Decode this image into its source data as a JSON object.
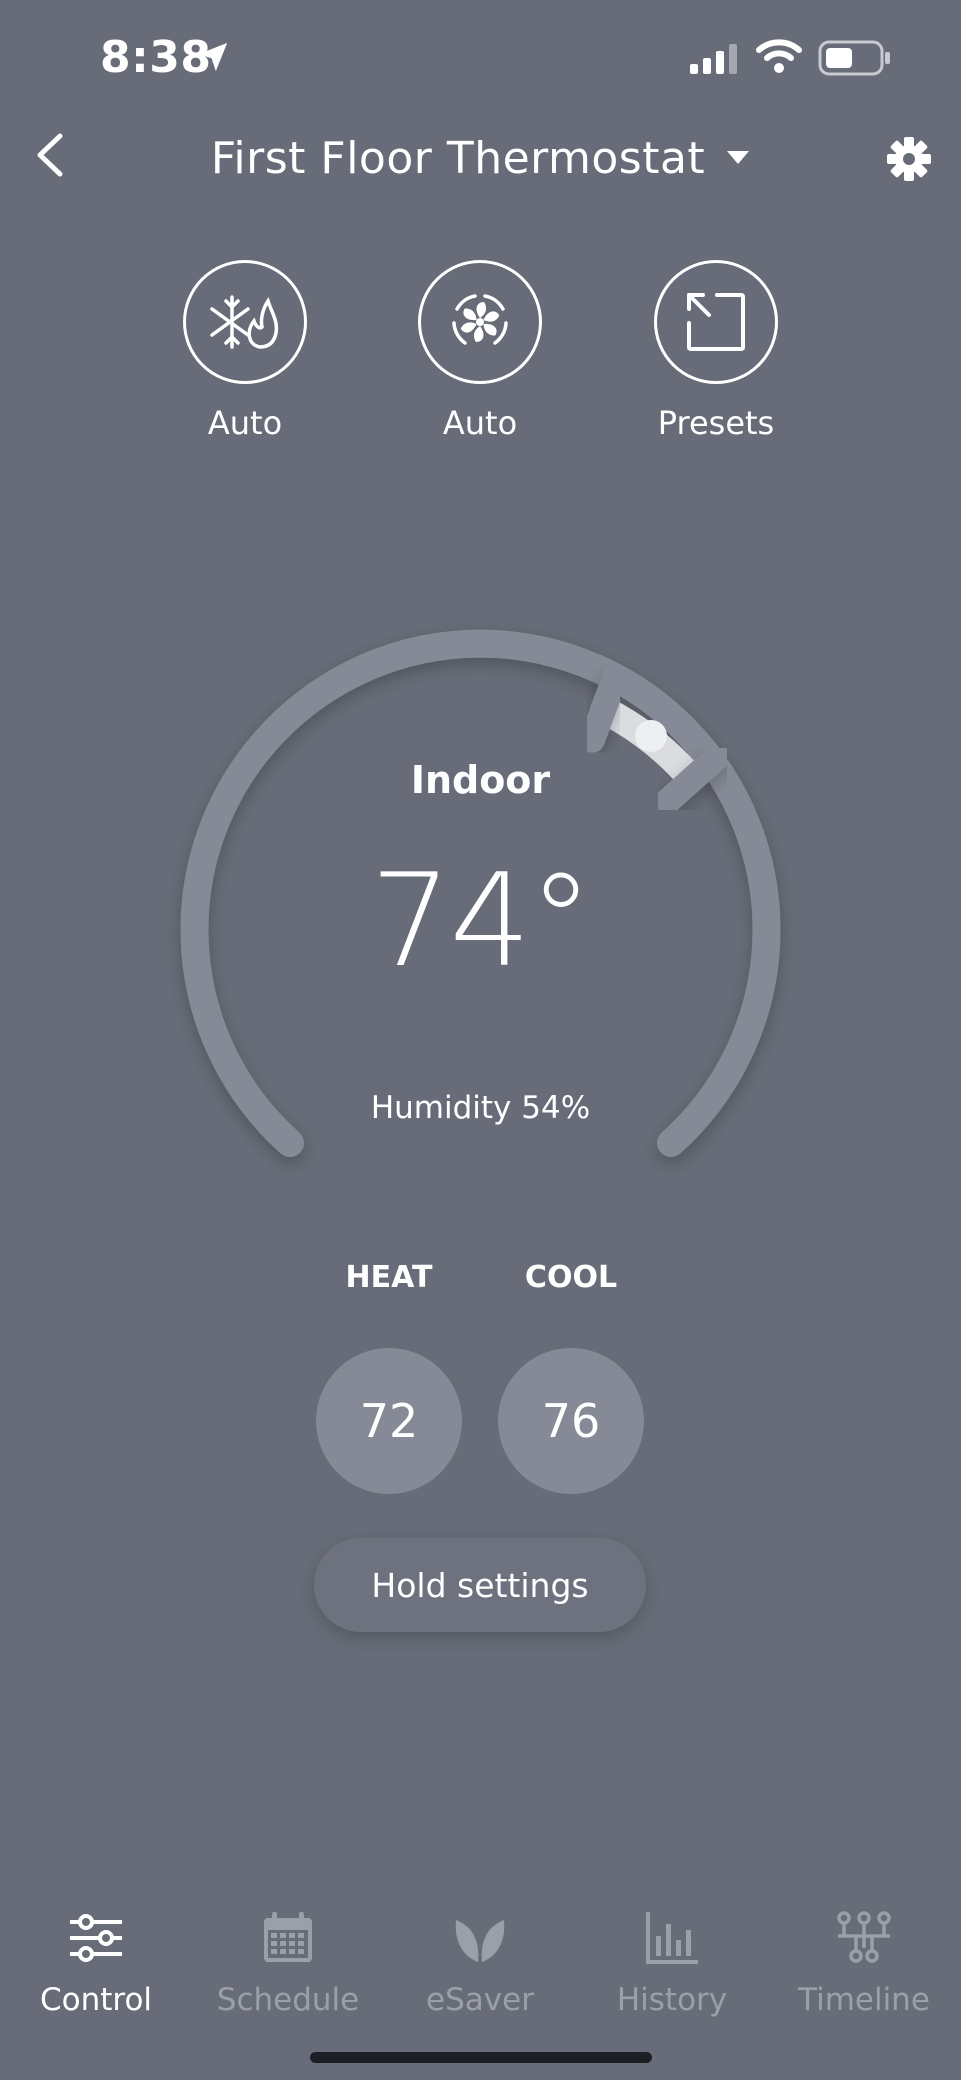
{
  "status_bar": {
    "time": "8:38"
  },
  "header": {
    "title": "First Floor Thermostat"
  },
  "modes": [
    {
      "label": "Auto",
      "icon": "heat-cool-mode-icon"
    },
    {
      "label": "Auto",
      "icon": "fan-mode-icon"
    },
    {
      "label": "Presets",
      "icon": "presets-icon"
    }
  ],
  "dial": {
    "label": "Indoor",
    "temperature": "74°",
    "humidity": "Humidity 54%"
  },
  "setpoints": {
    "heat_label": "HEAT",
    "heat_value": "72",
    "cool_label": "COOL",
    "cool_value": "76"
  },
  "hold_button": "Hold settings",
  "nav": [
    {
      "label": "Control",
      "icon": "sliders-icon",
      "active": true
    },
    {
      "label": "Schedule",
      "icon": "calendar-icon",
      "active": false
    },
    {
      "label": "eSaver",
      "icon": "leaf-icon",
      "active": false
    },
    {
      "label": "History",
      "icon": "bar-chart-icon",
      "active": false
    },
    {
      "label": "Timeline",
      "icon": "timeline-icon",
      "active": false
    }
  ],
  "colors": {
    "background": "#676c78",
    "dial_track": "#858a96",
    "setpoint_fill": "#858a96",
    "inactive_nav": "#9b9fa9"
  }
}
